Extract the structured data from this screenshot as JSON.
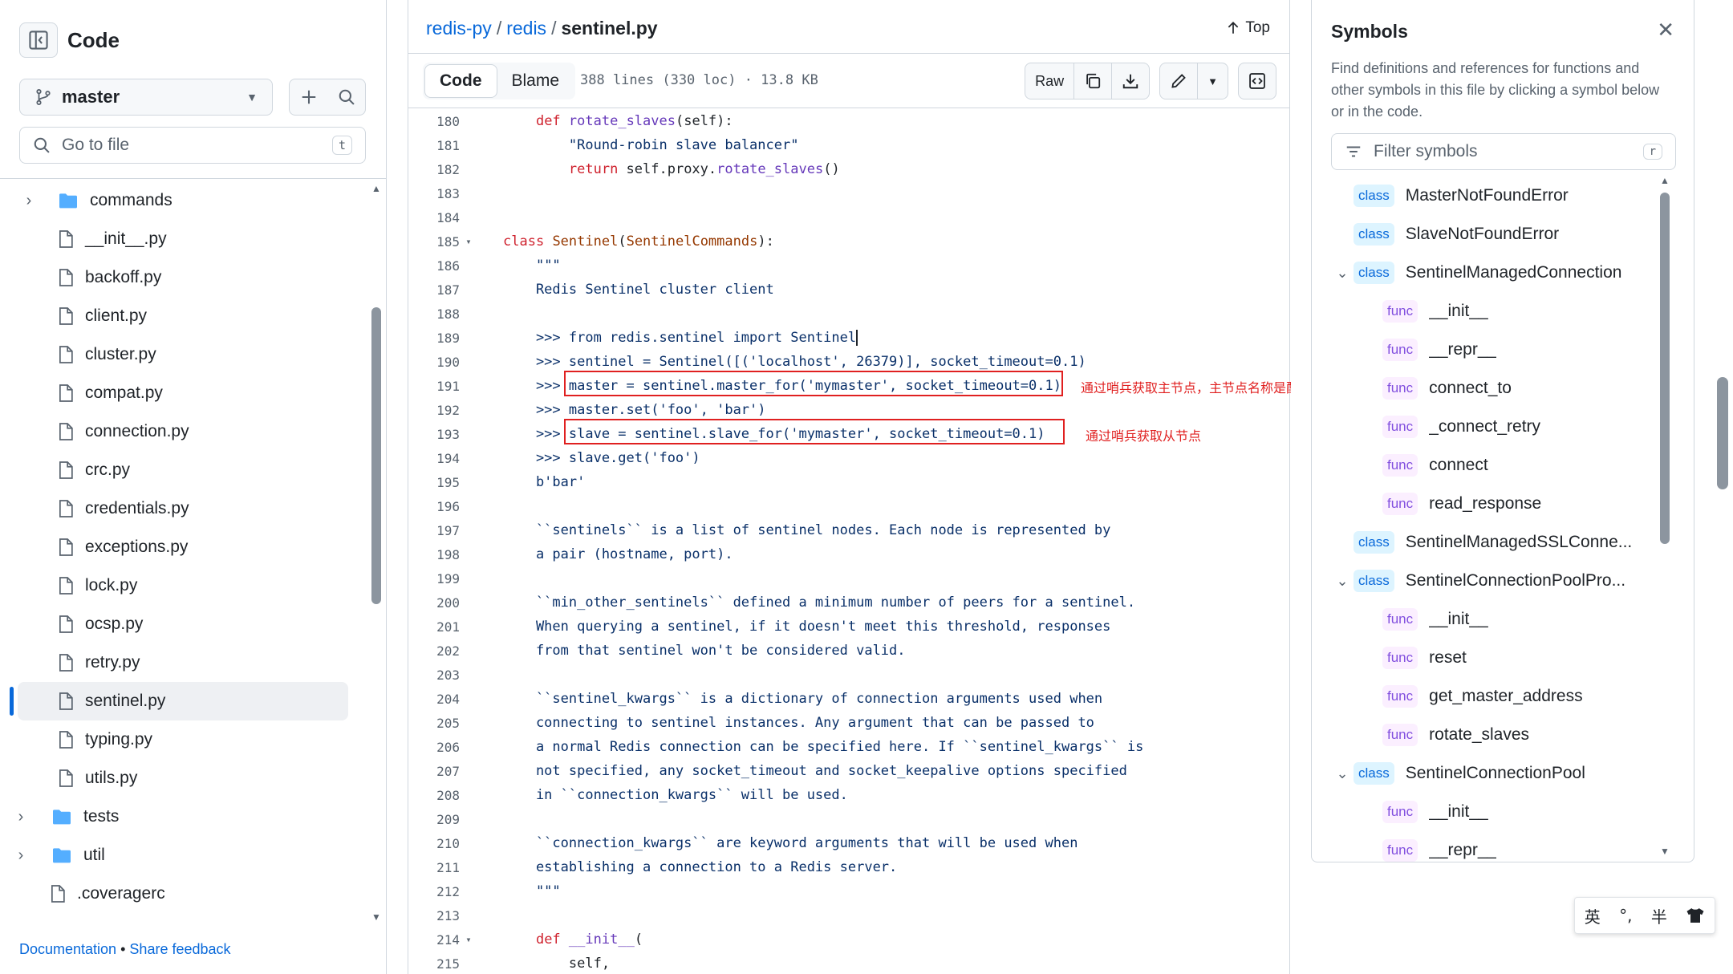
{
  "sidebar": {
    "title": "Code",
    "branch": "master",
    "goto_placeholder": "Go to file",
    "goto_shortcut": "t",
    "items": [
      {
        "label": "commands",
        "type": "folder",
        "indent": 1
      },
      {
        "label": "__init__.py",
        "type": "file",
        "indent": 1
      },
      {
        "label": "backoff.py",
        "type": "file",
        "indent": 1
      },
      {
        "label": "client.py",
        "type": "file",
        "indent": 1
      },
      {
        "label": "cluster.py",
        "type": "file",
        "indent": 1
      },
      {
        "label": "compat.py",
        "type": "file",
        "indent": 1
      },
      {
        "label": "connection.py",
        "type": "file",
        "indent": 1
      },
      {
        "label": "crc.py",
        "type": "file",
        "indent": 1
      },
      {
        "label": "credentials.py",
        "type": "file",
        "indent": 1
      },
      {
        "label": "exceptions.py",
        "type": "file",
        "indent": 1
      },
      {
        "label": "lock.py",
        "type": "file",
        "indent": 1
      },
      {
        "label": "ocsp.py",
        "type": "file",
        "indent": 1
      },
      {
        "label": "retry.py",
        "type": "file",
        "indent": 1
      },
      {
        "label": "sentinel.py",
        "type": "file",
        "indent": 1,
        "active": true
      },
      {
        "label": "typing.py",
        "type": "file",
        "indent": 1
      },
      {
        "label": "utils.py",
        "type": "file",
        "indent": 1
      },
      {
        "label": "tests",
        "type": "folder",
        "indent": 0
      },
      {
        "label": "util",
        "type": "folder",
        "indent": 0
      },
      {
        "label": ".coveragerc",
        "type": "file",
        "indent": 0
      }
    ],
    "footer": {
      "documentation": "Documentation",
      "separator": "•",
      "feedback": "Share feedback"
    }
  },
  "header": {
    "repo": "redis-py",
    "folder": "redis",
    "file": "sentinel.py",
    "top_label": "Top"
  },
  "toolbar": {
    "code_tab": "Code",
    "blame_tab": "Blame",
    "file_info": "388 lines (330 loc) · 13.8 KB",
    "raw_label": "Raw"
  },
  "code": {
    "lines": [
      {
        "n": "180",
        "html": "    <span class=\"kw\">def</span> <span class=\"fn\">rotate_slaves</span>(self):"
      },
      {
        "n": "181",
        "html": "        <span class=\"str\">\"Round-robin slave balancer\"</span>"
      },
      {
        "n": "182",
        "html": "        <span class=\"kw\">return</span> self.proxy.<span class=\"fn\">rotate_slaves</span>()"
      },
      {
        "n": "183",
        "html": ""
      },
      {
        "n": "184",
        "html": ""
      },
      {
        "n": "185",
        "fold": true,
        "html": "<span class=\"kw\">class</span> <span class=\"cls\">Sentinel</span>(<span class=\"cls\">SentinelCommands</span>):"
      },
      {
        "n": "186",
        "html": "    <span class=\"str\">\"\"\"</span>"
      },
      {
        "n": "187",
        "html": "<span class=\"str\">    Redis Sentinel cluster client</span>"
      },
      {
        "n": "188",
        "html": ""
      },
      {
        "n": "189",
        "html": "<span class=\"str\">    &gt;&gt;&gt; from redis.sentinel import Sentinel</span>"
      },
      {
        "n": "190",
        "html": "<span class=\"str\">    &gt;&gt;&gt; sentinel = Sentinel([('localhost', 26379)], socket_timeout=0.1)</span>"
      },
      {
        "n": "191",
        "html": "<span class=\"str\">    &gt;&gt;&gt; master = sentinel.master_for('mymaster', socket_timeout=0.1)</span>"
      },
      {
        "n": "192",
        "html": "<span class=\"str\">    &gt;&gt;&gt; master.set('foo', 'bar')</span>"
      },
      {
        "n": "193",
        "html": "<span class=\"str\">    &gt;&gt;&gt; slave = sentinel.slave_for('mymaster', socket_timeout=0.1)</span>"
      },
      {
        "n": "194",
        "html": "<span class=\"str\">    &gt;&gt;&gt; slave.get('foo')</span>"
      },
      {
        "n": "195",
        "html": "<span class=\"str\">    b'bar'</span>"
      },
      {
        "n": "196",
        "html": ""
      },
      {
        "n": "197",
        "html": "<span class=\"str\">    ``sentinels`` is a list of sentinel nodes. Each node is represented by</span>"
      },
      {
        "n": "198",
        "html": "<span class=\"str\">    a pair (hostname, port).</span>"
      },
      {
        "n": "199",
        "html": ""
      },
      {
        "n": "200",
        "html": "<span class=\"str\">    ``min_other_sentinels`` defined a minimum number of peers for a sentinel.</span>"
      },
      {
        "n": "201",
        "html": "<span class=\"str\">    When querying a sentinel, if it doesn't meet this threshold, responses</span>"
      },
      {
        "n": "202",
        "html": "<span class=\"str\">    from that sentinel won't be considered valid.</span>"
      },
      {
        "n": "203",
        "html": ""
      },
      {
        "n": "204",
        "html": "<span class=\"str\">    ``sentinel_kwargs`` is a dictionary of connection arguments used when</span>"
      },
      {
        "n": "205",
        "html": "<span class=\"str\">    connecting to sentinel instances. Any argument that can be passed to</span>"
      },
      {
        "n": "206",
        "html": "<span class=\"str\">    a normal Redis connection can be specified here. If ``sentinel_kwargs`` is</span>"
      },
      {
        "n": "207",
        "html": "<span class=\"str\">    not specified, any socket_timeout and socket_keepalive options specified</span>"
      },
      {
        "n": "208",
        "html": "<span class=\"str\">    in ``connection_kwargs`` will be used.</span>"
      },
      {
        "n": "209",
        "html": ""
      },
      {
        "n": "210",
        "html": "<span class=\"str\">    ``connection_kwargs`` are keyword arguments that will be used when</span>"
      },
      {
        "n": "211",
        "html": "<span class=\"str\">    establishing a connection to a Redis server.</span>"
      },
      {
        "n": "212",
        "html": "<span class=\"str\">    \"\"\"</span>"
      },
      {
        "n": "213",
        "html": ""
      },
      {
        "n": "214",
        "fold": true,
        "html": "    <span class=\"kw\">def</span> <span class=\"fn\">__init__</span>("
      },
      {
        "n": "215",
        "html": "        self,"
      }
    ],
    "annotations": {
      "master": "通过哨兵获取主节点，主节点名称是配置哨兵时配置的",
      "slave": "通过哨兵获取从节点"
    }
  },
  "symbols": {
    "title": "Symbols",
    "description": "Find definitions and references for functions and other symbols in this file by clicking a symbol below or in the code.",
    "filter_placeholder": "Filter symbols",
    "filter_shortcut": "r",
    "items": [
      {
        "kind": "class",
        "name": "MasterNotFoundError",
        "level": 0
      },
      {
        "kind": "class",
        "name": "SlaveNotFoundError",
        "level": 0
      },
      {
        "kind": "class",
        "name": "SentinelManagedConnection",
        "level": 0,
        "expanded": true
      },
      {
        "kind": "func",
        "name": "__init__",
        "level": 1
      },
      {
        "kind": "func",
        "name": "__repr__",
        "level": 1
      },
      {
        "kind": "func",
        "name": "connect_to",
        "level": 1
      },
      {
        "kind": "func",
        "name": "_connect_retry",
        "level": 1
      },
      {
        "kind": "func",
        "name": "connect",
        "level": 1
      },
      {
        "kind": "func",
        "name": "read_response",
        "level": 1
      },
      {
        "kind": "class",
        "name": "SentinelManagedSSLConne...",
        "level": 0
      },
      {
        "kind": "class",
        "name": "SentinelConnectionPoolPro...",
        "level": 0,
        "expanded": true
      },
      {
        "kind": "func",
        "name": "__init__",
        "level": 1
      },
      {
        "kind": "func",
        "name": "reset",
        "level": 1
      },
      {
        "kind": "func",
        "name": "get_master_address",
        "level": 1
      },
      {
        "kind": "func",
        "name": "rotate_slaves",
        "level": 1
      },
      {
        "kind": "class",
        "name": "SentinelConnectionPool",
        "level": 0,
        "expanded": true
      },
      {
        "kind": "func",
        "name": "__init__",
        "level": 1
      },
      {
        "kind": "func",
        "name": "__repr__",
        "level": 1
      }
    ]
  },
  "ime": {
    "lang": "英",
    "punct": "°,",
    "width": "半"
  },
  "colors": {
    "accent": "#0969da",
    "annotation": "#e02020",
    "class_badge": "#ddf4ff",
    "func_badge": "#fbefff"
  }
}
